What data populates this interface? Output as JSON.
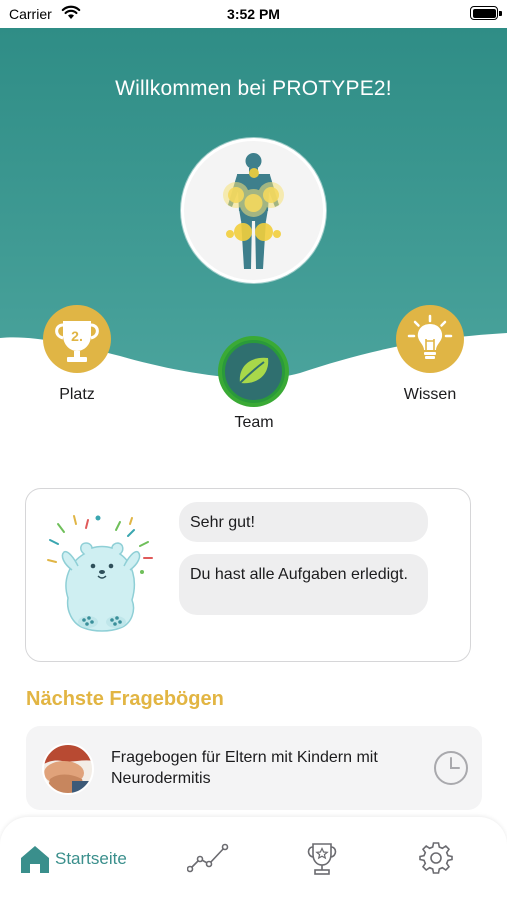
{
  "status_bar": {
    "carrier": "Carrier",
    "time": "3:52 PM"
  },
  "header": {
    "title": "Willkommen bei PROTYPE2!"
  },
  "quick_actions": {
    "platz": {
      "label": "Platz",
      "rank": "2."
    },
    "team": {
      "label": "Team"
    },
    "wissen": {
      "label": "Wissen"
    }
  },
  "status_card": {
    "messages": [
      "Sehr gut!",
      "Du hast alle Aufgaben erledigt."
    ]
  },
  "questionnaires": {
    "title": "Nächste Fragebögen",
    "items": [
      {
        "title": "Fragebogen für Eltern mit Kindern mit Neurodermitis"
      }
    ]
  },
  "tab_bar": {
    "items": [
      {
        "icon": "home-icon",
        "label": "Startseite",
        "active": true
      },
      {
        "icon": "chart-line-icon",
        "active": false
      },
      {
        "icon": "trophy-icon",
        "active": false
      },
      {
        "icon": "gear-icon",
        "active": false
      }
    ]
  },
  "colors": {
    "header_teal": "#3f9a95",
    "accent_gold": "#e0b545",
    "team_green": "#3aaa35",
    "active_tab": "#3a8f8c"
  }
}
